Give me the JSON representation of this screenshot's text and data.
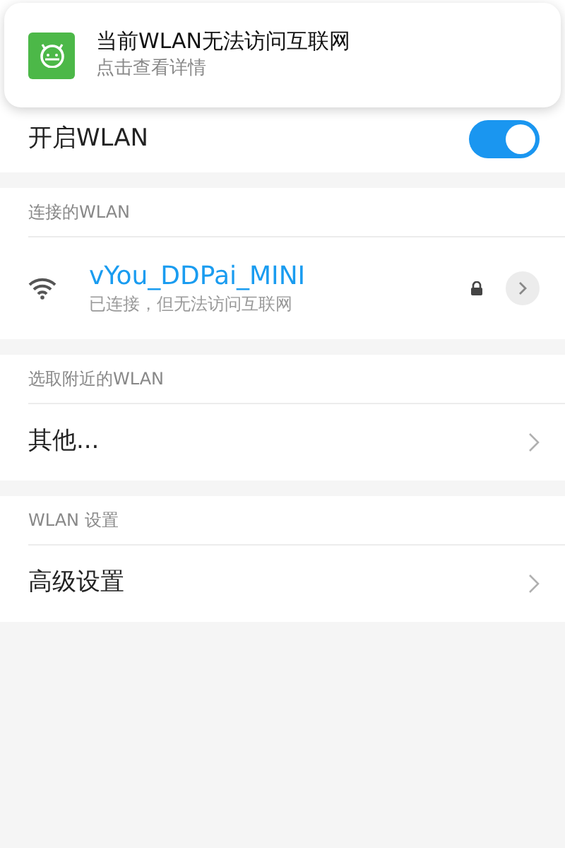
{
  "notification": {
    "title": "当前WLAN无法访问互联网",
    "subtitle": "点击查看详情"
  },
  "wlan_toggle": {
    "label": "开启WLAN",
    "on": true
  },
  "sections": [
    {
      "header": "连接的WLAN",
      "items": [
        {
          "kind": "network",
          "name": "vYou_DDPai_MINI",
          "status": "已连接，但无法访问互联网",
          "locked": true
        }
      ]
    },
    {
      "header": "选取附近的WLAN",
      "items": [
        {
          "kind": "link",
          "label": "其他..."
        }
      ]
    },
    {
      "header": "WLAN 设置",
      "items": [
        {
          "kind": "link",
          "label": "高级设置"
        }
      ]
    }
  ]
}
